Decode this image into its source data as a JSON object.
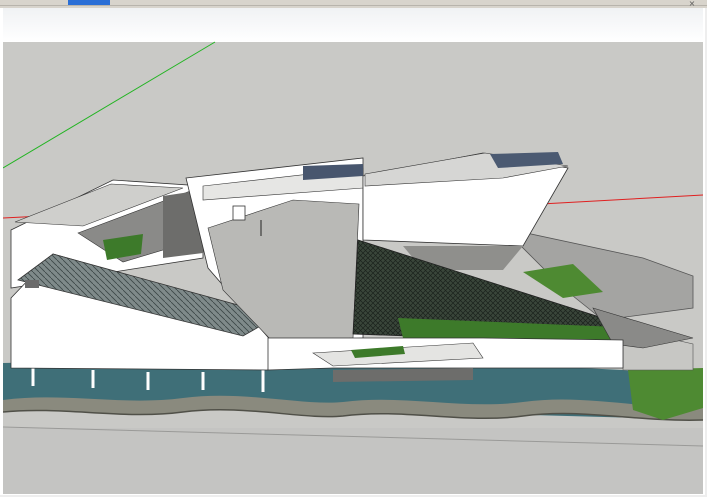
{
  "window": {
    "active_tab_color": "#2b6fd6",
    "close_icon": "×"
  },
  "viewport": {
    "sky_color": "#ffffff",
    "ground_color": "#c9c9c6",
    "axes": {
      "green_axis_color": "#22b422",
      "red_axis_color": "#e02020"
    }
  },
  "model": {
    "water_color": "#3f6f78",
    "lawn_color": "#4e8a32",
    "roof_glass_color": "#2f3a30"
  }
}
